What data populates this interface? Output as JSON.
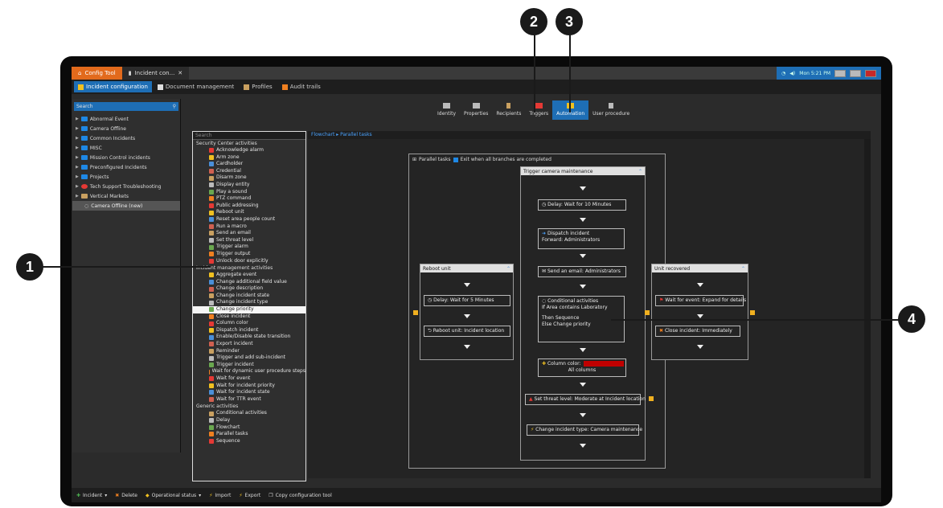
{
  "window": {
    "tabs": [
      {
        "label": "Config Tool"
      },
      {
        "label": "Incident con..."
      }
    ],
    "clock": "Mon 5:21 PM"
  },
  "subtabs": [
    "Incident configuration",
    "Document management",
    "Profiles",
    "Audit trails"
  ],
  "left_panel": {
    "search_placeholder": "Search",
    "items": [
      "Abnormal Event",
      "Camera Offline",
      "Common Incidents",
      "MISC",
      "Mission Control incidents",
      "Preconfigured Incidents",
      "Projects",
      "Tech Support Troubleshooting",
      "Vertical Markets",
      "Camera Offline (new)"
    ]
  },
  "config_tabs": [
    "Identity",
    "Properties",
    "Recipients",
    "Triggers",
    "Automation",
    "User procedure"
  ],
  "palette": {
    "search_placeholder": "Search",
    "groups": [
      {
        "name": "Security Center activities",
        "items": [
          "Acknowledge alarm",
          "Arm zone",
          "Cardholder",
          "Credential",
          "Disarm zone",
          "Display entity",
          "Play a sound",
          "PTZ command",
          "Public addressing",
          "Reboot unit",
          "Reset area people count",
          "Run a macro",
          "Send an email",
          "Set threat level",
          "Trigger alarm",
          "Trigger output",
          "Unlock door explicitly"
        ]
      },
      {
        "name": "Incident management activities",
        "items": [
          "Aggregate event",
          "Change additional field value",
          "Change description",
          "Change incident state",
          "Change incident type",
          "Change priority",
          "Close incident",
          "Column color",
          "Dispatch incident",
          "Enable/Disable state transition",
          "Export incident",
          "Reminder",
          "Trigger and add sub-incident",
          "Trigger incident",
          "Wait for dynamic user procedure steps",
          "Wait for event",
          "Wait for incident priority",
          "Wait for incident state",
          "Wait for TTR event"
        ]
      },
      {
        "name": "Generic activities",
        "items": [
          "Conditional activities",
          "Delay",
          "Flowchart",
          "Parallel tasks",
          "Sequence"
        ]
      }
    ],
    "selected": "Change priority"
  },
  "breadcrumb": {
    "root": "Flowchart",
    "sep": "▸",
    "current": "Parallel tasks"
  },
  "flow": {
    "parallel_label": "Parallel tasks",
    "exit_label": "Exit when all branches are completed",
    "left_col": {
      "title": "Reboot unit",
      "delay": "Delay:  Wait for 5 Minutes",
      "reboot": "Reboot unit:  Incident location"
    },
    "center_col": {
      "title": "Trigger camera maintenance",
      "delay": "Delay:  Wait for 10 Minutes",
      "dispatch_title": "Dispatch incident",
      "dispatch_sub": "Forward: Administrators",
      "email": "Send an email:  Administrators",
      "cond_title": "Conditional activities",
      "cond_if": "If Area contains Laboratory",
      "cond_then": "Then Sequence",
      "cond_else": "Else Change priority",
      "colcolor": "Column color:",
      "colcolor_sub": "All columns",
      "threat": "Set threat level:  Moderate at Incident location",
      "type": "Change incident type:  Camera maintenance"
    },
    "right_col": {
      "title": "Unit recovered",
      "wait": "Wait for event:  Expand for details",
      "close": "Close incident:  Immediately"
    }
  },
  "bottom": [
    "Incident",
    "Delete",
    "Operational status",
    "Import",
    "Export",
    "Copy configuration tool"
  ],
  "markers": [
    "1",
    "2",
    "3",
    "4"
  ],
  "colors": {
    "accent": "#1e6eb5",
    "home_tab": "#e26a1c",
    "column_color": "#c00000"
  }
}
